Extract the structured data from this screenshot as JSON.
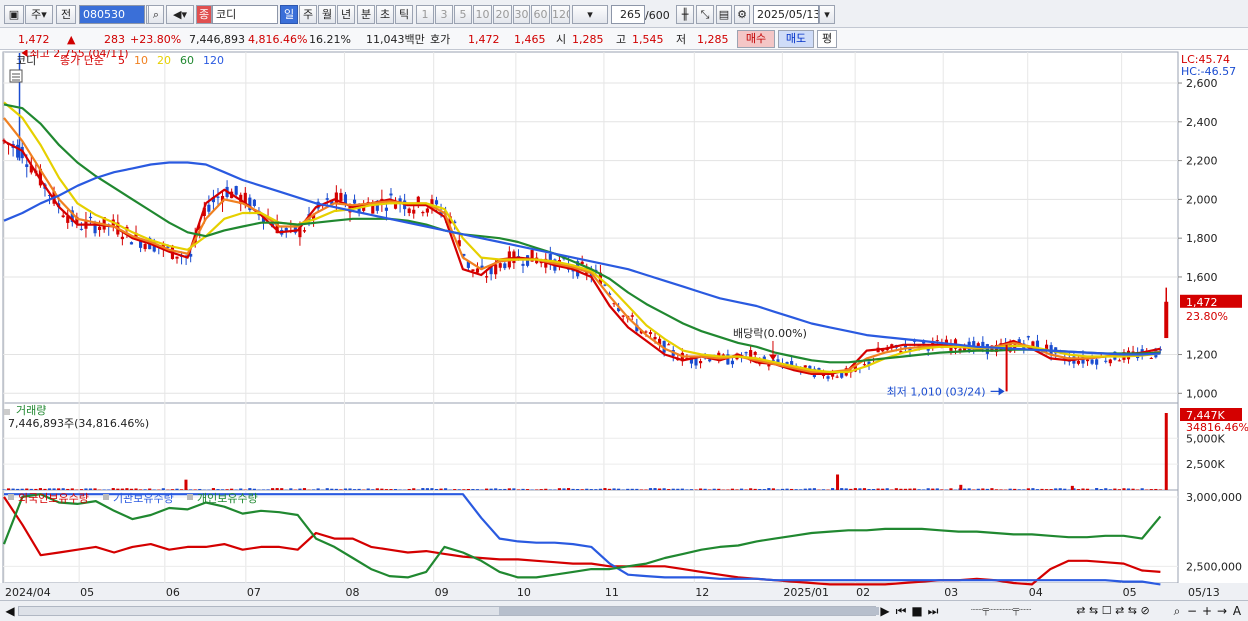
{
  "toolbar": {
    "period_unit": "주",
    "compare_label": "전",
    "stock_code": "080530",
    "stock_type_badge": "종",
    "stock_name": "코디",
    "tabs": [
      "일",
      "주",
      "월",
      "년",
      "분",
      "초",
      "틱"
    ],
    "active_tab": "일",
    "intervals": [
      "1",
      "3",
      "5",
      "10",
      "20",
      "30",
      "60",
      "120"
    ],
    "count_value": "265",
    "count_total": "/600",
    "date_value": "2025/05/13"
  },
  "quote": {
    "price": "1,472",
    "change_arrow": "▲",
    "change": "283",
    "change_pct": "+23.80%",
    "volume": "7,446,893",
    "volume_ratio": "4,816.46%",
    "turnover": "16.21%",
    "trade_value": "11,043백만",
    "bid_label": "호가",
    "ask_price": "1,472",
    "bid_price": "1,465",
    "open_label": "시",
    "open_price": "1,285",
    "high_label": "고",
    "high_price": "1,545",
    "low_label": "저",
    "low_price": "1,285",
    "buy_label": "매수",
    "sell_label": "매도",
    "eval_label": "평"
  },
  "price_panel": {
    "legend_name": "코디",
    "legend_ma_title": "종가 단순",
    "ma_periods": [
      "5",
      "10",
      "20",
      "60",
      "120"
    ],
    "ma_colors": [
      "#d40000",
      "#f08020",
      "#e6d000",
      "#208830",
      "#2a5ae0"
    ],
    "lc_label": "LC:45.74",
    "hc_label": "HC:-46.57",
    "high_annotation": "최고 2,755 (04/11)",
    "low_annotation": "최저 1,010 (03/24)",
    "dividend_annotation": "배당락(0.00%)",
    "current_price_tag": "1,472",
    "current_pct_tag": "23.80%",
    "yticks": [
      "2,600",
      "2,400",
      "2,200",
      "2,000",
      "1,800",
      "1,600",
      "1,200",
      "1,000"
    ]
  },
  "volume_panel": {
    "title": "거래량",
    "value_text": "7,446,893주(34,816.46%)",
    "tag_value": "7,447K",
    "tag_pct": "34816.46%",
    "yticks": [
      "5,000K",
      "2,500K"
    ]
  },
  "holding_panel": {
    "series_labels": [
      "외국인보유수량",
      "기관보유수량",
      "개인보유수량"
    ],
    "series_colors": [
      "#d40000",
      "#2a5ae0",
      "#208830"
    ],
    "yticks": [
      "3,000,000",
      "2,500,000"
    ]
  },
  "xaxis": {
    "labels": [
      "2024/04",
      "05",
      "06",
      "07",
      "08",
      "09",
      "10",
      "11",
      "12",
      "2025/01",
      "02",
      "03",
      "04",
      "05"
    ],
    "right_label": "05/13"
  },
  "chart_data": {
    "type": "candlestick",
    "price_ma_series": [
      {
        "name": "5",
        "color": "#d40000",
        "values": [
          2300,
          2250,
          2100,
          1960,
          1870,
          1870,
          1860,
          1800,
          1770,
          1730,
          1700,
          1980,
          2050,
          1990,
          1920,
          1830,
          1840,
          1960,
          2000,
          1960,
          1980,
          2000,
          1970,
          1970,
          1910,
          1640,
          1610,
          1690,
          1700,
          1690,
          1660,
          1640,
          1600,
          1450,
          1340,
          1270,
          1200,
          1170,
          1190,
          1170,
          1200,
          1160,
          1150,
          1120,
          1100,
          1100,
          1120,
          1220,
          1230,
          1250,
          1250,
          1250,
          1240,
          1230,
          1240,
          1270,
          1230,
          1180,
          1170,
          1180,
          1190,
          1200,
          1210,
          1230
        ]
      },
      {
        "name": "10",
        "color": "#f08020",
        "values": [
          2420,
          2300,
          2150,
          2000,
          1900,
          1880,
          1860,
          1810,
          1780,
          1740,
          1720,
          1900,
          2000,
          1980,
          1930,
          1860,
          1860,
          1930,
          1980,
          1970,
          1980,
          1990,
          1980,
          1980,
          1930,
          1700,
          1640,
          1680,
          1690,
          1690,
          1670,
          1650,
          1620,
          1500,
          1390,
          1300,
          1230,
          1190,
          1190,
          1180,
          1190,
          1170,
          1150,
          1130,
          1110,
          1110,
          1120,
          1180,
          1210,
          1230,
          1240,
          1240,
          1240,
          1230,
          1240,
          1260,
          1240,
          1200,
          1180,
          1180,
          1190,
          1195,
          1200,
          1215
        ]
      },
      {
        "name": "20",
        "color": "#e6d000",
        "values": [
          2500,
          2420,
          2280,
          2110,
          1980,
          1920,
          1880,
          1830,
          1790,
          1760,
          1740,
          1810,
          1900,
          1930,
          1930,
          1880,
          1870,
          1900,
          1940,
          1950,
          1970,
          1980,
          1980,
          1980,
          1950,
          1800,
          1700,
          1690,
          1690,
          1690,
          1680,
          1660,
          1630,
          1550,
          1450,
          1350,
          1280,
          1220,
          1200,
          1190,
          1190,
          1180,
          1160,
          1140,
          1120,
          1110,
          1110,
          1140,
          1180,
          1210,
          1230,
          1240,
          1240,
          1235,
          1235,
          1245,
          1240,
          1220,
          1200,
          1190,
          1190,
          1190,
          1195,
          1205
        ]
      },
      {
        "name": "60",
        "color": "#208830",
        "values": [
          2490,
          2470,
          2390,
          2280,
          2190,
          2120,
          2060,
          2000,
          1940,
          1880,
          1830,
          1810,
          1840,
          1860,
          1880,
          1880,
          1870,
          1880,
          1890,
          1900,
          1900,
          1900,
          1890,
          1870,
          1840,
          1820,
          1810,
          1800,
          1780,
          1750,
          1720,
          1680,
          1640,
          1590,
          1520,
          1460,
          1410,
          1360,
          1320,
          1290,
          1260,
          1240,
          1210,
          1190,
          1170,
          1160,
          1160,
          1170,
          1180,
          1190,
          1200,
          1210,
          1215,
          1220,
          1220,
          1225,
          1225,
          1220,
          1215,
          1210,
          1205,
          1205,
          1205,
          1210
        ]
      },
      {
        "name": "120",
        "color": "#2a5ae0",
        "values": [
          1890,
          1930,
          1980,
          2020,
          2070,
          2110,
          2140,
          2160,
          2180,
          2190,
          2190,
          2180,
          2140,
          2100,
          2070,
          2040,
          2010,
          1980,
          1960,
          1940,
          1920,
          1900,
          1880,
          1860,
          1840,
          1820,
          1800,
          1780,
          1760,
          1740,
          1720,
          1700,
          1680,
          1660,
          1640,
          1610,
          1580,
          1550,
          1520,
          1490,
          1470,
          1450,
          1420,
          1390,
          1360,
          1340,
          1320,
          1300,
          1290,
          1280,
          1270,
          1260,
          1250,
          1240,
          1235,
          1230,
          1225,
          1220,
          1215,
          1210,
          1205,
          1200,
          1200,
          1205
        ]
      }
    ],
    "last_candle": {
      "open": 1285,
      "high": 1545,
      "low": 1285,
      "close": 1472
    },
    "price_range": [
      950,
      2760
    ],
    "volume_spikes_k": [
      {
        "pos": 0.155,
        "v": 1000
      },
      {
        "pos": 0.71,
        "v": 1500
      },
      {
        "pos": 0.815,
        "v": 500
      },
      {
        "pos": 0.91,
        "v": 400
      },
      {
        "pos": 0.99,
        "v": 7447
      }
    ],
    "volume_range_k": [
      0,
      7447
    ],
    "holding_series": [
      {
        "name": "외국인보유수량",
        "color": "#d40000",
        "values": [
          3000000,
          2800000,
          2580000,
          2600000,
          2620000,
          2640000,
          2600000,
          2640000,
          2660000,
          2620000,
          2640000,
          2640000,
          2660000,
          2620000,
          2640000,
          2640000,
          2620000,
          2740000,
          2700000,
          2700000,
          2640000,
          2620000,
          2600000,
          2610000,
          2590000,
          2570000,
          2560000,
          2550000,
          2550000,
          2540000,
          2530000,
          2520000,
          2520000,
          2500000,
          2500000,
          2500000,
          2500000,
          2480000,
          2460000,
          2440000,
          2420000,
          2410000,
          2400000,
          2390000,
          2380000,
          2370000,
          2370000,
          2370000,
          2370000,
          2380000,
          2390000,
          2400000,
          2400000,
          2410000,
          2400000,
          2380000,
          2370000,
          2480000,
          2540000,
          2540000,
          2530000,
          2520000,
          2470000,
          2460000
        ]
      },
      {
        "name": "기관보유수량",
        "color": "#2a5ae0",
        "values": [
          3020000,
          3020000,
          3020000,
          3020000,
          3020000,
          3020000,
          3020000,
          3020000,
          3020000,
          3020000,
          3020000,
          3020000,
          3020000,
          3020000,
          3020000,
          3020000,
          3020000,
          3020000,
          3020000,
          3020000,
          3020000,
          3020000,
          3020000,
          3020000,
          3020000,
          3020000,
          2850000,
          2700000,
          2680000,
          2670000,
          2670000,
          2660000,
          2640000,
          2520000,
          2440000,
          2430000,
          2420000,
          2420000,
          2420000,
          2410000,
          2410000,
          2410000,
          2400000,
          2400000,
          2400000,
          2400000,
          2400000,
          2400000,
          2400000,
          2400000,
          2400000,
          2400000,
          2400000,
          2400000,
          2400000,
          2400000,
          2400000,
          2400000,
          2400000,
          2400000,
          2400000,
          2390000,
          2390000,
          2370000
        ]
      },
      {
        "name": "개인보유수량",
        "color": "#208830",
        "values": [
          2660000,
          3000000,
          3020000,
          2960000,
          2950000,
          2970000,
          2900000,
          2840000,
          2870000,
          2920000,
          2910000,
          2960000,
          2930000,
          2880000,
          2900000,
          2890000,
          2870000,
          2700000,
          2640000,
          2560000,
          2480000,
          2430000,
          2420000,
          2460000,
          2640000,
          2600000,
          2540000,
          2460000,
          2420000,
          2420000,
          2440000,
          2460000,
          2480000,
          2480000,
          2500000,
          2520000,
          2560000,
          2590000,
          2620000,
          2640000,
          2650000,
          2680000,
          2700000,
          2720000,
          2740000,
          2750000,
          2760000,
          2760000,
          2770000,
          2770000,
          2770000,
          2760000,
          2750000,
          2750000,
          2740000,
          2730000,
          2730000,
          2720000,
          2710000,
          2710000,
          2720000,
          2720000,
          2700000,
          2860000
        ]
      }
    ],
    "holding_range": [
      2380000,
      3050000
    ],
    "dividend_pos": 0.655,
    "low_pos": 0.854,
    "high_pos": 0.003
  }
}
